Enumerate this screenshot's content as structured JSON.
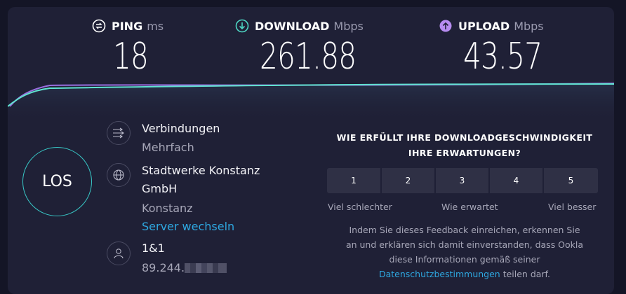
{
  "metrics": {
    "ping": {
      "label": "PING",
      "unit": "ms",
      "value": "18",
      "icon": "ping-icon",
      "color": "#ffffff"
    },
    "download": {
      "label": "DOWNLOAD",
      "unit": "Mbps",
      "value": "261.88",
      "icon": "download-arrow-icon",
      "color": "#4ed6c4"
    },
    "upload": {
      "label": "UPLOAD",
      "unit": "Mbps",
      "value": "43.57",
      "icon": "upload-arrow-icon",
      "color": "#b78cf0"
    }
  },
  "go_button": {
    "label": "LOS",
    "ring_color": "#38c7c6"
  },
  "connections": {
    "icon": "connections-icon",
    "title": "Verbindungen",
    "value": "Mehrfach"
  },
  "server": {
    "icon": "globe-icon",
    "provider_line1": "Stadtwerke Konstanz",
    "provider_line2": "GmbH",
    "location": "Konstanz",
    "change_link": "Server wechseln"
  },
  "client": {
    "icon": "user-icon",
    "isp": "1&1",
    "ip_prefix": "89.244."
  },
  "survey": {
    "question_line1": "WIE ERFÜLLT IHRE DOWNLOADGESCHWINDIGKEIT",
    "question_line2": "IHRE ERWARTUNGEN?",
    "options": [
      "1",
      "2",
      "3",
      "4",
      "5"
    ],
    "low_label": "Viel schlechter",
    "mid_label": "Wie erwartet",
    "high_label": "Viel besser"
  },
  "disclaimer": {
    "line1": "Indem Sie dieses Feedback einreichen, erkennen Sie",
    "line2": "an und erklären sich damit einverstanden, dass Ookla",
    "line3": "diese Informationen gemäß seiner",
    "link": "Datenschutzbestimmungen",
    "suffix": " teilen darf."
  },
  "colors": {
    "background": "#141526",
    "panel": "#1f2036",
    "accent_cyan": "#38c7c6",
    "accent_purple": "#b78cf0",
    "link": "#2ea7e0"
  }
}
